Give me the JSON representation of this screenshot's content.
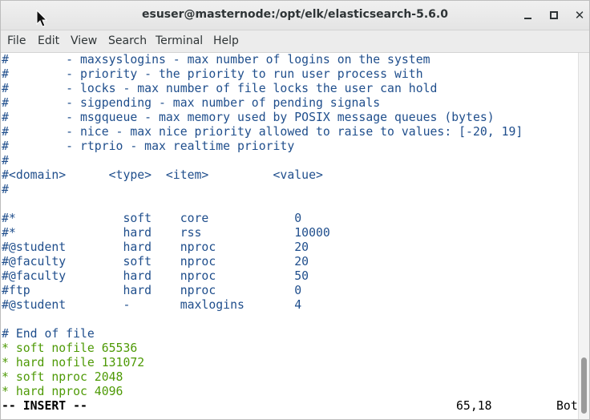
{
  "window": {
    "title": "esuser@masternode:/opt/elk/elasticsearch-5.6.0",
    "buttons": {
      "minimize_icon": "minimize-icon",
      "maximize_icon": "maximize-icon",
      "close_icon": "close-icon",
      "close_glyph": "✕"
    }
  },
  "menubar": {
    "items": [
      "File",
      "Edit",
      "View",
      "Search",
      "Terminal",
      "Help"
    ]
  },
  "terminal": {
    "colors": {
      "comment": "#1f4e8c",
      "entry": "#4e9a06",
      "status": "#000000"
    },
    "lines": [
      "#        - maxsyslogins - max number of logins on the system",
      "#        - priority - the priority to run user process with",
      "#        - locks - max number of file locks the user can hold",
      "#        - sigpending - max number of pending signals",
      "#        - msgqueue - max memory used by POSIX message queues (bytes)",
      "#        - nice - max nice priority allowed to raise to values: [-20, 19]",
      "#        - rtprio - max realtime priority",
      "#",
      "#<domain>      <type>  <item>         <value>",
      "#",
      "",
      "#*               soft    core            0",
      "#*               hard    rss             10000",
      "#@student        hard    nproc           20",
      "#@faculty        soft    nproc           20",
      "#@faculty        hard    nproc           50",
      "#ftp             hard    nproc           0",
      "#@student        -       maxlogins       4",
      "",
      "# End of file",
      "* soft nofile 65536",
      "* hard nofile 131072",
      "* soft nproc 2048",
      "* hard nproc 4096"
    ],
    "status_mode": "-- INSERT --",
    "cursor_position": "65,18",
    "scroll_position": "Bot"
  }
}
